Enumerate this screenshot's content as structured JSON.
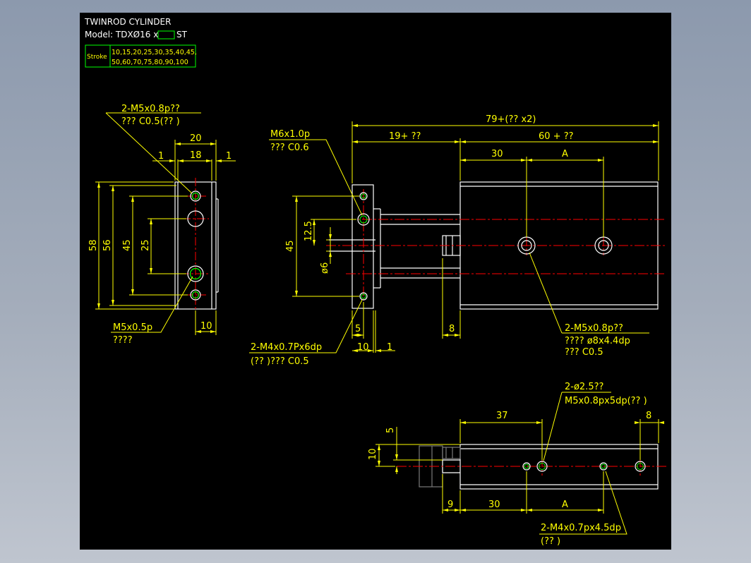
{
  "colors": {
    "frame_bg": "#9aa4b3",
    "drawing_bg": "#000000",
    "outline": "#ffffff",
    "dimension": "#ffff00",
    "centerline": "#ff0000",
    "hole_inner": "#00ff00",
    "table_border": "#00ff00"
  },
  "title": {
    "line1": "TWINROD CYLINDER",
    "model_prefix": "Model: TDXØ16 x",
    "model_suffix": "ST"
  },
  "stroke_table": {
    "label": "Stroke",
    "row1": "10,15,20,25,30,35,40,45,",
    "row2": "50,60,70,75,80,90,100"
  },
  "left_view": {
    "note1_l1": "2-M5x0.8p??",
    "note1_l2": "???   C0.5(??  )",
    "d_20": "20",
    "d_1a": "1",
    "d_18": "18",
    "d_1b": "1",
    "d_58": "58",
    "d_56": "56",
    "d_45": "45",
    "d_25": "25",
    "d_10": "10",
    "note2_l1": "M5x0.5p",
    "note2_l2": "????"
  },
  "front_view": {
    "note1_l1": "M6x1.0p",
    "note1_l2": "???    C0.6",
    "d_total": "79+(??  x2)",
    "d_19": "19+ ??",
    "d_60": "60 + ??",
    "d_30": "30",
    "d_A": "A",
    "d_45": "45",
    "d_125": "12.5",
    "d_6": "ø6",
    "d_5": "5",
    "d_10": "10",
    "d_1": "1",
    "d_8": "8",
    "note2_l1": "2-M4x0.7Px6dp",
    "note2_l2": "(??  )???    C0.5",
    "note3_l1": "2-M5x0.8p??",
    "note3_l2": "????      ø8x4.4dp",
    "note3_l3": "???     C0.5"
  },
  "bottom_view": {
    "note1_l1": "2-ø2.5??",
    "note1_l2": "M5x0.8px5dp(??  )",
    "d_37": "37",
    "d_8": "8",
    "d_5": "5",
    "d_10": "10",
    "d_9": "9",
    "d_30": "30",
    "d_A": "A",
    "note2_l1": "2-M4x0.7px4.5dp",
    "note2_l2": "(??  )"
  }
}
